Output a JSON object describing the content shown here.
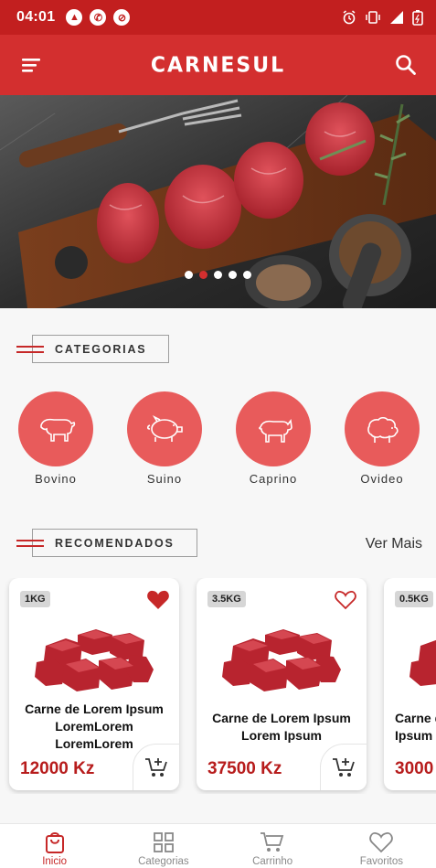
{
  "status_bar": {
    "time": "04:01",
    "notification_icons": [
      "vpn-icon",
      "whatsapp-icon",
      "circle-icon"
    ],
    "system_icons": [
      "alarm-icon",
      "vibrate-icon",
      "signal-icon",
      "battery-icon"
    ]
  },
  "app_bar": {
    "title": "CARNESUL",
    "menu_icon": "hamburger-menu-icon",
    "search_icon": "search-icon"
  },
  "banner": {
    "slide_count": 5,
    "active_index": 1
  },
  "categories": {
    "title": "CATEGORIAS",
    "items": [
      {
        "label": "Bovino",
        "icon": "cow-icon"
      },
      {
        "label": "Suino",
        "icon": "pig-icon"
      },
      {
        "label": "Caprino",
        "icon": "goat-icon"
      },
      {
        "label": "Ovideo",
        "icon": "sheep-icon"
      }
    ]
  },
  "recommended": {
    "title": "RECOMENDADOS",
    "see_more": "Ver Mais",
    "products": [
      {
        "weight": "1KG",
        "name": "Carne de Lorem Ipsum LoremLorem LoremLorem",
        "price": "12000 Kz",
        "favorite": true
      },
      {
        "weight": "3.5KG",
        "name": "Carne de Lorem Ipsum Lorem Ipsum",
        "price": "37500 Kz",
        "favorite": false
      },
      {
        "weight": "0.5KG",
        "name": "Carne de Lorem Ipsum Lorem",
        "price": "3000",
        "favorite": false
      }
    ]
  },
  "bottom_nav": {
    "items": [
      {
        "label": "Inicio",
        "icon": "bag-icon",
        "active": true
      },
      {
        "label": "Categorias",
        "icon": "grid-icon",
        "active": false
      },
      {
        "label": "Carrinho",
        "icon": "cart-icon",
        "active": false
      },
      {
        "label": "Favoritos",
        "icon": "heart-icon",
        "active": false
      }
    ]
  },
  "colors": {
    "primary": "#d32f2f",
    "status_bar": "#c21f1f",
    "category_circle": "#e85b5b",
    "price": "#b71c1c"
  }
}
